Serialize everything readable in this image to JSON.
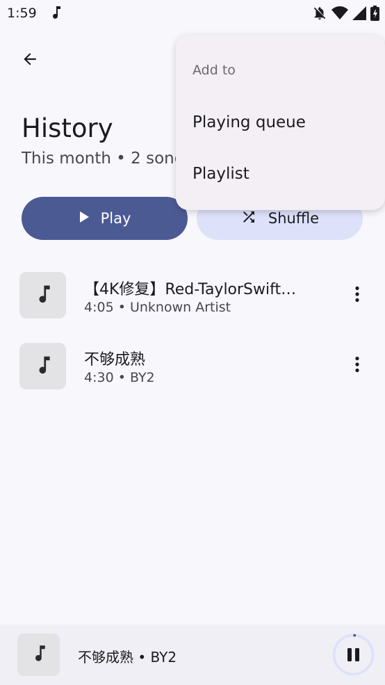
{
  "status_bar": {
    "time": "1:59"
  },
  "page": {
    "title": "History",
    "subtitle": "This month • 2 songs"
  },
  "actions": {
    "play_label": "Play",
    "shuffle_label": "Shuffle"
  },
  "songs": [
    {
      "title": "【4K修复】Red-TaylorSwift…",
      "meta": "4:05 • Unknown Artist"
    },
    {
      "title": "不够成熟",
      "meta": "4:30 • BY2"
    }
  ],
  "menu": {
    "header": "Add to",
    "items": [
      {
        "label": "Playing queue"
      },
      {
        "label": "Playlist"
      }
    ]
  },
  "mini_player": {
    "text": "不够成熟 • BY2",
    "progress": 0.02
  },
  "colors": {
    "accent": "#4c5a93",
    "accent_container": "#dde1fa",
    "background": "#f8f7fc",
    "menu_bg": "#f3eff5"
  },
  "icons": [
    "music-note-icon",
    "bell-off-icon",
    "wifi-icon",
    "signal-icon",
    "battery-icon",
    "arrow-back-icon",
    "play-icon",
    "shuffle-icon",
    "more-vert-icon",
    "pause-icon"
  ]
}
